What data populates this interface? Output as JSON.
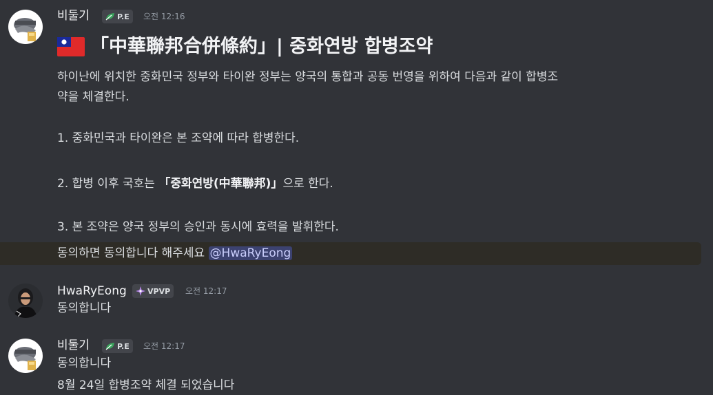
{
  "messages": [
    {
      "author": "비둘기",
      "badge": "P.E",
      "time": "오전 12:16",
      "heading": "「中華聯邦合併條約」| 중화연방 합병조약",
      "flag_icon": "taiwan-flag",
      "lines": [
        "하이난에 위치한 중화민국 정부와 타이완 정부는 양국의 통합과 공동 번영을 위하여 다음과 같이 합병조",
        "약을 체결한다.",
        "1. 중화민국과 타이완은 본 조약에 따라 합병한다.",
        "2. 합병 이후 국호는 ",
        "「중화연방(中華聯邦)」",
        "으로 한다.",
        "3. 본 조약은 양국 정부의 승인과 동시에 효력을 발휘한다.",
        "동의하면 동의합니다 해주세요 "
      ],
      "mention": "@HwaRyEong"
    },
    {
      "author": "HwaRyEong",
      "badge": "VPVP",
      "time": "오전 12:17",
      "lines": [
        "동의합니다"
      ]
    },
    {
      "author": "비둘기",
      "badge": "P.E",
      "time": "오전 12:17",
      "lines": [
        "동의합니다",
        "8월 24일 합병조약 체결 되었습니다"
      ]
    }
  ],
  "colors": {
    "background": "#313338",
    "mention_bg": "#3c4270",
    "mention_text": "#c9cdfb",
    "highlight_bg": "#2e2c26",
    "badge_leaf": "#3ba55d",
    "badge_vpvp": "#b586e8"
  }
}
